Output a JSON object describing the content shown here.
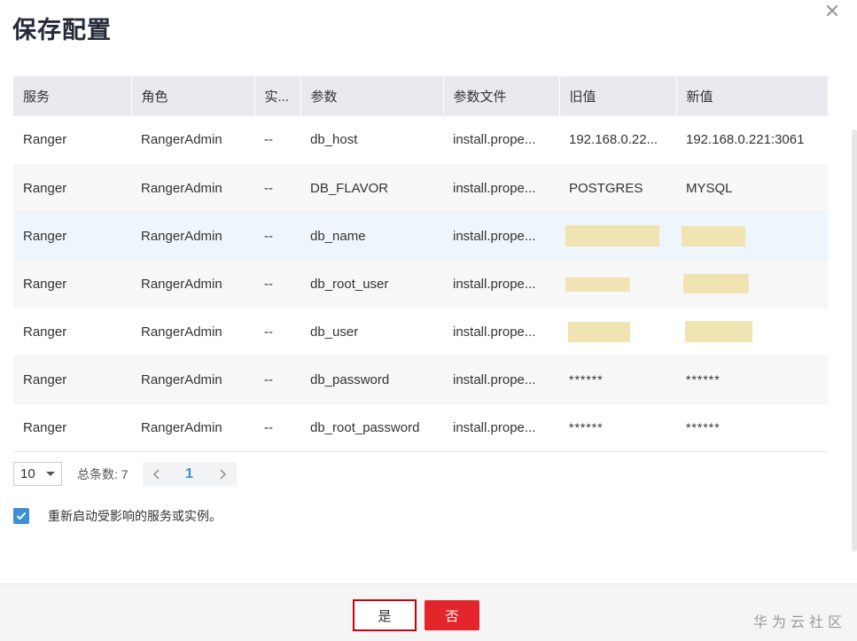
{
  "dialog": {
    "title": "保存配置"
  },
  "table": {
    "headers": [
      "服务",
      "角色",
      "实...",
      "参数",
      "参数文件",
      "旧值",
      "新值"
    ],
    "rows": [
      [
        "Ranger",
        "RangerAdmin",
        "--",
        "db_host",
        "install.prope...",
        "192.168.0.22...",
        "192.168.0.221:3061"
      ],
      [
        "Ranger",
        "RangerAdmin",
        "--",
        "DB_FLAVOR",
        "install.prope...",
        "POSTGRES",
        "MYSQL"
      ],
      [
        "Ranger",
        "RangerAdmin",
        "--",
        "db_name",
        "install.prope...",
        "",
        ""
      ],
      [
        "Ranger",
        "RangerAdmin",
        "--",
        "db_root_user",
        "install.prope...",
        "",
        ""
      ],
      [
        "Ranger",
        "RangerAdmin",
        "--",
        "db_user",
        "install.prope...",
        "",
        ""
      ],
      [
        "Ranger",
        "RangerAdmin",
        "--",
        "db_password",
        "install.prope...",
        "******",
        "******"
      ],
      [
        "Ranger",
        "RangerAdmin",
        "--",
        "db_root_password",
        "install.prope...",
        "******",
        "******"
      ]
    ]
  },
  "pagination": {
    "page_size": "10",
    "total_label": "总条数: 7",
    "current_page": "1"
  },
  "restart_option": {
    "label": "重新启动受影响的服务或实例。",
    "checked": true
  },
  "footer": {
    "yes_label": "是",
    "no_label": "否",
    "watermark": "华为云社区"
  },
  "colors": {
    "accent_blue": "#3b8fd6",
    "primary_red": "#e3262c",
    "focus_border": "#c7000b",
    "redaction": "#f1e4b3"
  }
}
